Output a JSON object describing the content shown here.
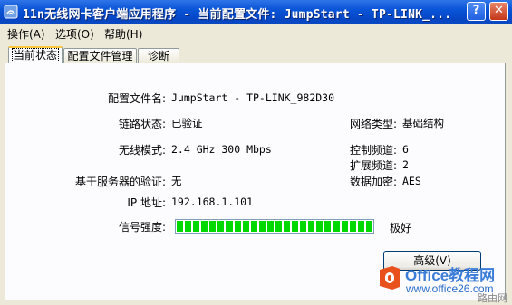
{
  "window": {
    "title": "11n无线网卡客户端应用程序 - 当前配置文件: JumpStart - TP-LINK_...",
    "help_button": "?",
    "close_button": "✕",
    "title_color": "#0a55d8"
  },
  "menu": [
    {
      "label": "操作(A)"
    },
    {
      "label": "选项(O)"
    },
    {
      "label": "帮助(H)"
    }
  ],
  "tabs": [
    {
      "label": "当前状态",
      "active": true
    },
    {
      "label": "配置文件管理",
      "active": false
    },
    {
      "label": "诊断",
      "active": false
    }
  ],
  "status": {
    "profile_label": "配置文件名:",
    "profile_value": "JumpStart - TP-LINK_982D30",
    "link_label": "链路状态:",
    "link_value": "已验证",
    "mode_label": "无线模式:",
    "mode_value": "2.4 GHz 300 Mbps",
    "server_auth_label": "基于服务器的验证:",
    "server_auth_value": "无",
    "ip_label": "IP 地址:",
    "ip_value": "192.168.1.101",
    "network_type_label": "网络类型:",
    "network_type_value": "基础结构",
    "control_channel_label": "控制频道:",
    "control_channel_value": "6",
    "ext_channel_label": "扩展频道:",
    "ext_channel_value": "2",
    "encryption_label": "数据加密:",
    "encryption_value": "AES",
    "signal_label": "信号强度:",
    "signal_text": "极好",
    "signal_level": 1.0,
    "signal_color": "#00d800"
  },
  "buttons": {
    "advanced": "高级(V)"
  },
  "watermark": {
    "brand": "Office教程网",
    "url": "www.office26.com",
    "corner": "路由网"
  }
}
